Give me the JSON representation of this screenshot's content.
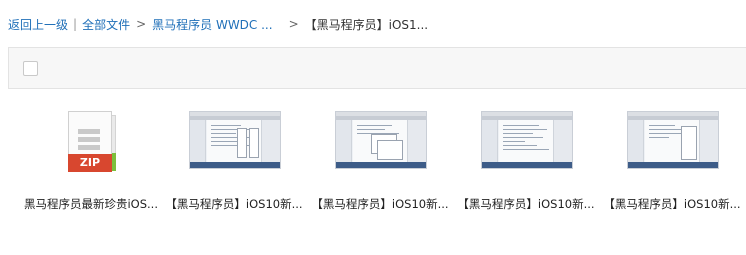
{
  "breadcrumb": {
    "back": "返回上一级",
    "separator": "|",
    "all_files": "全部文件",
    "arrow1": ">",
    "folder": "黑马程序员 WWDC ...",
    "arrow2": ">",
    "current": "【黑马程序员】iOS1..."
  },
  "toolbar": {
    "select_all_checked": false
  },
  "files": [
    {
      "name": "黑马程序员最新珍贵iOS...",
      "type": "zip",
      "badge": "ZIP"
    },
    {
      "name": "【黑马程序员】iOS10新...",
      "type": "image"
    },
    {
      "name": "【黑马程序员】iOS10新...",
      "type": "image"
    },
    {
      "name": "【黑马程序员】iOS10新...",
      "type": "image"
    },
    {
      "name": "【黑马程序员】iOS10新...",
      "type": "image"
    }
  ],
  "colors": {
    "link": "#1f6fb8",
    "zip_red": "#d8472f",
    "zip_green": "#7cbf3c"
  }
}
